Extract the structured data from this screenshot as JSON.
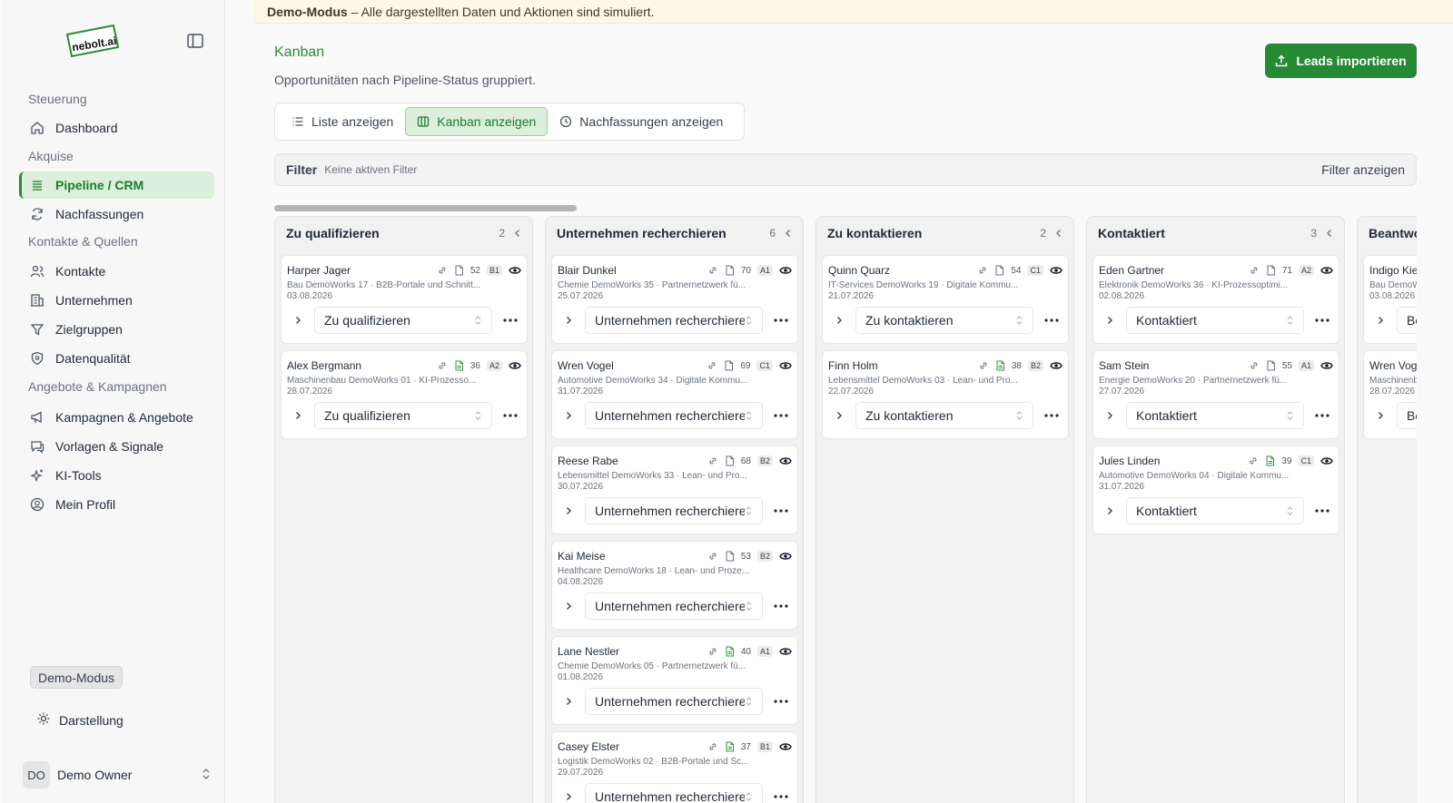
{
  "sidebar": {
    "logo_text": "nebolt.ai",
    "sections": {
      "steuerung": "Steuerung",
      "akquise": "Akquise",
      "kontakte_quellen": "Kontakte & Quellen",
      "angebote_kampagnen": "Angebote & Kampagnen"
    },
    "items": {
      "dashboard": "Dashboard",
      "pipeline": "Pipeline / CRM",
      "nachfassungen": "Nachfassungen",
      "kontakte": "Kontakte",
      "unternehmen": "Unternehmen",
      "zielgruppen": "Zielgruppen",
      "datenqualitaet": "Datenqualität",
      "kampagnen": "Kampagnen & Angebote",
      "vorlagen": "Vorlagen & Signale",
      "ki_tools": "KI-Tools",
      "profil": "Mein Profil"
    },
    "demo_badge": "Demo-Modus",
    "darstellung": "Darstellung",
    "user": {
      "initials": "DO",
      "name": "Demo Owner"
    }
  },
  "banner": {
    "strong": "Demo-Modus",
    "text": "– Alle dargestellten Daten und Aktionen sind simuliert."
  },
  "header": {
    "title": "Kanban",
    "subtitle": "Opportunitäten nach Pipeline-Status gruppiert.",
    "import_label": "Leads importieren"
  },
  "view_tabs": {
    "list": "Liste anzeigen",
    "kanban": "Kanban anzeigen",
    "followups": "Nachfassungen anzeigen"
  },
  "filter": {
    "label": "Filter",
    "status": "Keine aktiven Filter",
    "button": "Filter anzeigen"
  },
  "columns": [
    {
      "title": "Zu qualifizieren",
      "count": "2",
      "cards": [
        {
          "name": "Harper Jager",
          "score": "52",
          "grade": "B1",
          "doc": "gray",
          "line": "Bau DemoWorks 17 · B2B-Portale und Schnitt...",
          "date": "03.08.2026",
          "status": "Zu qualifizieren"
        },
        {
          "name": "Alex Bergmann",
          "score": "36",
          "grade": "A2",
          "doc": "green",
          "line": "Maschinenbau DemoWorks 01 · KI-Prozesso...",
          "date": "28.07.2026",
          "status": "Zu qualifizieren"
        }
      ]
    },
    {
      "title": "Unternehmen recherchieren",
      "count": "6",
      "cards": [
        {
          "name": "Blair Dunkel",
          "score": "70",
          "grade": "A1",
          "doc": "gray",
          "line": "Chemie DemoWorks 35 · Partnernetzwerk fü...",
          "date": "25.07.2026",
          "status": "Unternehmen recherchieren"
        },
        {
          "name": "Wren Vogel",
          "score": "69",
          "grade": "C1",
          "doc": "gray",
          "line": "Automotive DemoWorks 34 · Digitale Kommu...",
          "date": "31.07.2026",
          "status": "Unternehmen recherchieren"
        },
        {
          "name": "Reese Rabe",
          "score": "68",
          "grade": "B2",
          "doc": "gray",
          "line": "Lebensmittel DemoWorks 33 · Lean- und Pro...",
          "date": "30.07.2026",
          "status": "Unternehmen recherchieren"
        },
        {
          "name": "Kai Meise",
          "score": "53",
          "grade": "B2",
          "doc": "gray",
          "line": "Healthcare DemoWorks 18 · Lean- und Proze...",
          "date": "04.08.2026",
          "status": "Unternehmen recherchieren"
        },
        {
          "name": "Lane Nestler",
          "score": "40",
          "grade": "A1",
          "doc": "green",
          "line": "Chemie DemoWorks 05 · Partnernetzwerk fü...",
          "date": "01.08.2026",
          "status": "Unternehmen recherchieren"
        },
        {
          "name": "Casey Elster",
          "score": "37",
          "grade": "B1",
          "doc": "green",
          "line": "Logistik DemoWorks 02 · B2B-Portale und Sc...",
          "date": "29.07.2026",
          "status": "Unternehmen recherchieren"
        }
      ]
    },
    {
      "title": "Zu kontaktieren",
      "count": "2",
      "cards": [
        {
          "name": "Quinn Quarz",
          "score": "54",
          "grade": "C1",
          "doc": "gray",
          "line": "IT-Services DemoWorks 19 · Digitale Kommu...",
          "date": "21.07.2026",
          "status": "Zu kontaktieren"
        },
        {
          "name": "Finn Holm",
          "score": "38",
          "grade": "B2",
          "doc": "green",
          "line": "Lebensmittel DemoWorks 03 · Lean- und Pro...",
          "date": "22.07.2026",
          "status": "Zu kontaktieren"
        }
      ]
    },
    {
      "title": "Kontaktiert",
      "count": "3",
      "cards": [
        {
          "name": "Eden Gartner",
          "score": "71",
          "grade": "A2",
          "doc": "gray",
          "line": "Elektronik DemoWorks 36 · KI-Prozessoptimi...",
          "date": "02.08.2026",
          "status": "Kontaktiert"
        },
        {
          "name": "Sam Stein",
          "score": "55",
          "grade": "A1",
          "doc": "gray",
          "line": "Energie DemoWorks 20 · Partnernetzwerk fü...",
          "date": "27.07.2026",
          "status": "Kontaktiert"
        },
        {
          "name": "Jules Linden",
          "score": "39",
          "grade": "C1",
          "doc": "green",
          "line": "Automotive DemoWorks 04 · Digitale Kommu...",
          "date": "31.07.2026",
          "status": "Kontaktiert"
        }
      ]
    },
    {
      "title": "Beantwortet",
      "count": "",
      "cards": [
        {
          "name": "Indigo Kiefer",
          "score": "",
          "grade": "",
          "doc": "gray",
          "line": "Bau DemoWorks",
          "date": "03.08.2026",
          "status": "Beantwortet"
        },
        {
          "name": "Wren Vogel",
          "score": "",
          "grade": "",
          "doc": "gray",
          "line": "Maschinenbau",
          "date": "28.07.2026",
          "status": "Beantwortet"
        }
      ]
    }
  ]
}
